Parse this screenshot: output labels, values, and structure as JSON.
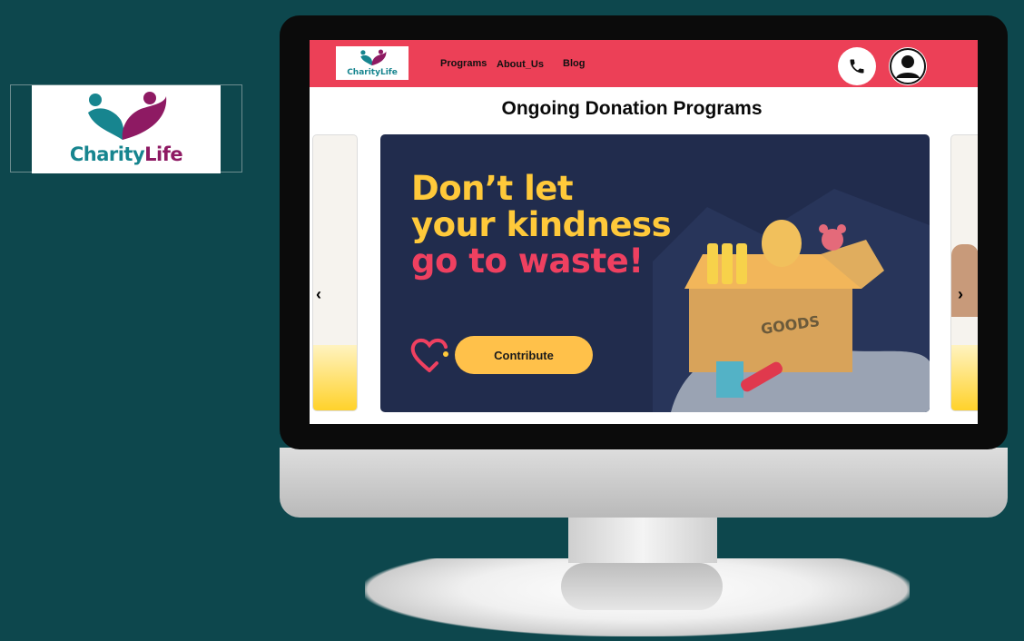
{
  "logo_card": {
    "brand_part1": "Charity",
    "brand_part2": "Life"
  },
  "navbar": {
    "logo_text": "CharityLife",
    "links": [
      "Programs",
      "About_Us",
      "Blog"
    ],
    "icons": [
      "phone-icon",
      "user-icon"
    ]
  },
  "page": {
    "title": "Ongoing Donation Programs"
  },
  "banner": {
    "line1": "Don’t let",
    "line2": "your kindness",
    "line3": "go to waste!",
    "button_label": "Contribute",
    "box_label": "GOODS"
  },
  "carousel": {
    "prev_icon": "chevron-left-icon",
    "next_icon": "chevron-right-icon"
  },
  "colors": {
    "background": "#0d474d",
    "navbar": "#ec4057",
    "banner": "#212c4d",
    "accent_yellow": "#ffc93a",
    "accent_pink": "#ef4060",
    "brand_teal": "#17858f",
    "brand_purple": "#8e1a63"
  }
}
